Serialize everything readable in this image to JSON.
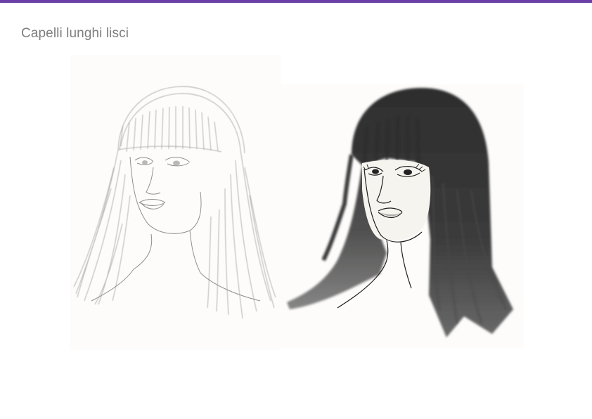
{
  "page": {
    "title": "Capelli lunghi lisci"
  },
  "colors": {
    "accent_bar": "#6a3fa8",
    "title_text": "#7d7d7d",
    "paper": "#fbfaf7",
    "pencil": "#9a9a9a",
    "ink_dark": "#2e2e2e",
    "ink_mid": "#6d6d6d"
  },
  "illustrations": [
    {
      "name": "pencil-sketch",
      "medium": "pencil"
    },
    {
      "name": "ink-wash-painting",
      "medium": "ink wash"
    }
  ]
}
